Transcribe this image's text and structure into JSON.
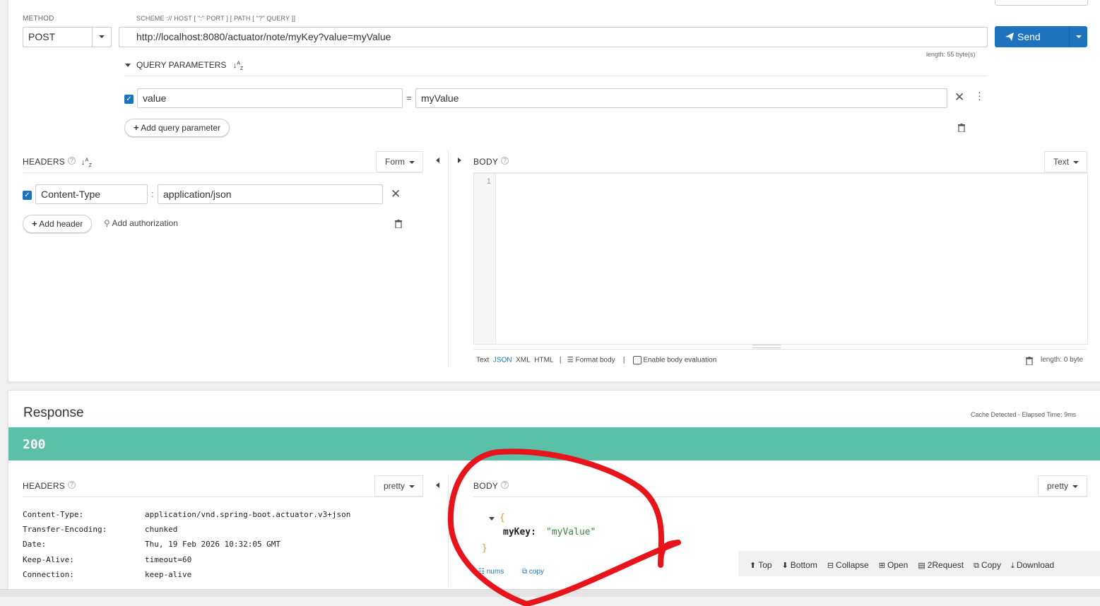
{
  "request": {
    "method_label": "METHOD",
    "method_value": "POST",
    "url_hint": "SCHEME :// HOST [ \":\" PORT ] [ PATH [ \"?\" QUERY ]]",
    "url_value": "http://localhost:8080/actuator/note/myKey?value=myValue",
    "url_length": "length: 55 byte(s)",
    "send_label": "Send",
    "query_params_title": "QUERY PARAMETERS",
    "query_params": [
      {
        "name": "value",
        "sep": "=",
        "value": "myValue"
      }
    ],
    "add_query_param_label": "Add query parameter",
    "headers_title": "HEADERS",
    "headers_mode": "Form",
    "headers": [
      {
        "name": "Content-Type",
        "sep": ":",
        "value": "application/json"
      }
    ],
    "add_header_label": "Add header",
    "add_authorization_label": "Add authorization",
    "body_title": "BODY",
    "body_mode": "Text",
    "body_line_number": "1",
    "body_formats": [
      "Text",
      "JSON",
      "XML",
      "HTML"
    ],
    "format_body_label": "Format body",
    "enable_body_eval_label": "Enable body evaluation",
    "body_length": "length: 0 byte",
    "separator": "|"
  },
  "response": {
    "title": "Response",
    "cache_info": "Cache Detected - Elapsed Time: 9ms",
    "status_code": "200",
    "status_color": "#5bc0a8",
    "headers_title": "HEADERS",
    "headers_mode": "pretty",
    "body_title": "BODY",
    "body_mode": "pretty",
    "headers": [
      {
        "name": "Content-Type:",
        "value": "application/vnd.spring-boot.actuator.v3+json"
      },
      {
        "name": "Transfer-Encoding:",
        "value": "chunked"
      },
      {
        "name": "Date:",
        "value": "Thu, 19 Feb 2026 10:32:05 GMT"
      },
      {
        "name": "Keep-Alive:",
        "value": "timeout=60"
      },
      {
        "name": "Connection:",
        "value": "keep-alive"
      }
    ],
    "body_json": {
      "open_brace": "{",
      "close_brace": "}",
      "key": "myKey:",
      "value": "\"myValue\""
    },
    "body_links": {
      "nums": "nums",
      "copy": "copy"
    },
    "toolbar": {
      "top": "Top",
      "bottom": "Bottom",
      "collapse": "Collapse",
      "open": "Open",
      "to_request": "2Request",
      "copy": "Copy",
      "download": "Download"
    }
  },
  "colors": {
    "send_button": "#1e73be",
    "link": "#1e73be",
    "annotation": "#e8141b"
  }
}
